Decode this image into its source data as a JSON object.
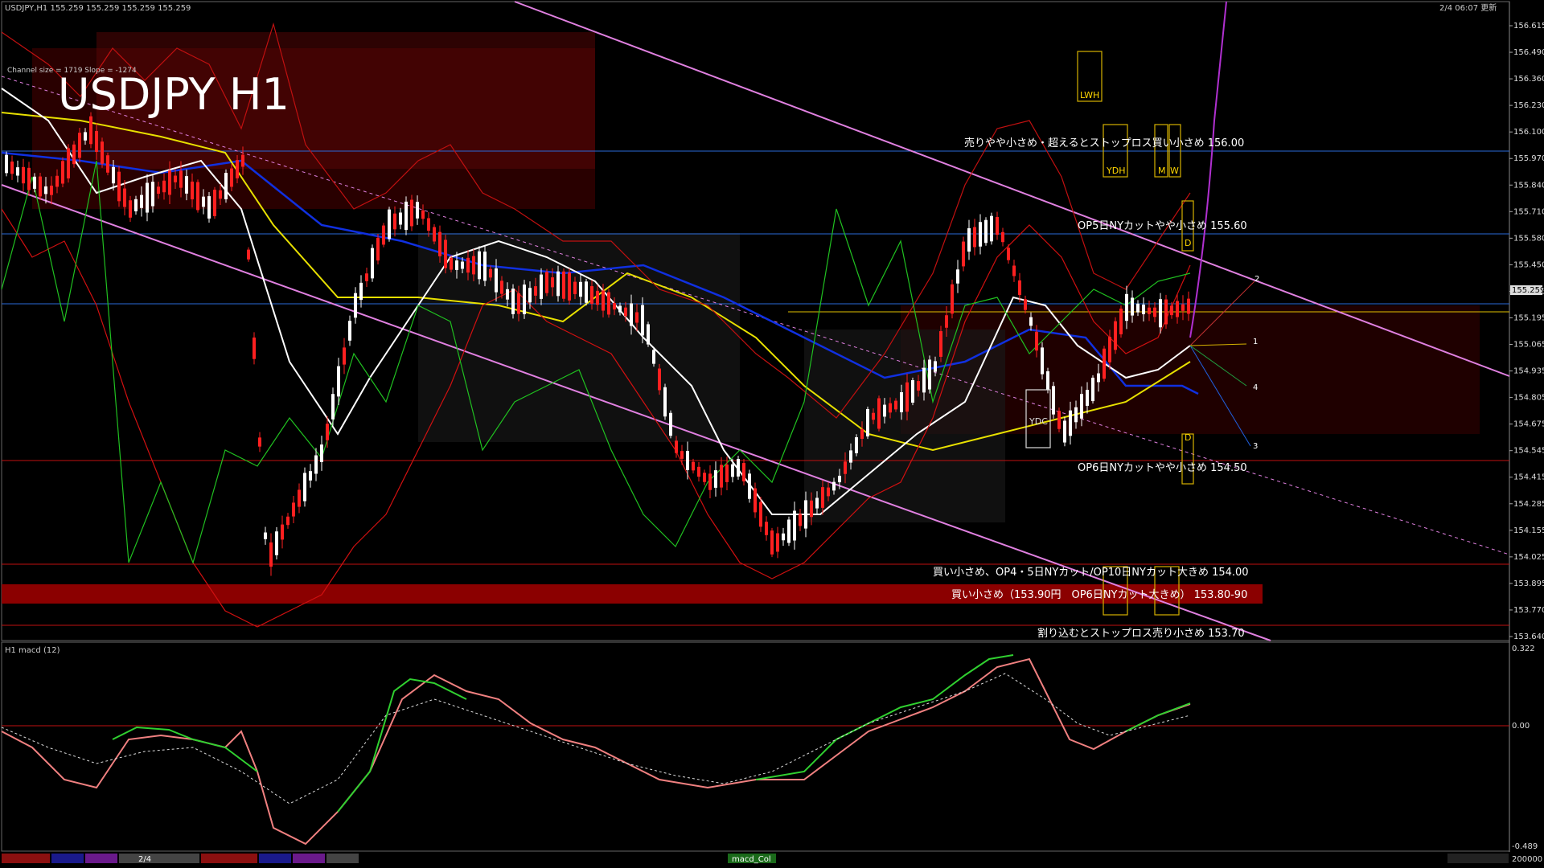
{
  "chart": {
    "header_info": "USDJPY,H1 155.259 155.259 155.259 155.259",
    "timestamp": "2/4 06:07 更新",
    "title": "USDJPY H1",
    "channel_info": "Channel size = 1719 Slope = -1274",
    "current_price": "155.259"
  },
  "chart_data": {
    "type": "line",
    "y_axis_ticks": [
      "156.615",
      "156.490",
      "156.360",
      "156.230",
      "156.100",
      "155.970",
      "155.840",
      "155.710",
      "155.580",
      "155.450",
      "155.325",
      "155.195",
      "155.065",
      "154.935",
      "154.805",
      "154.675",
      "154.545",
      "154.415",
      "154.285",
      "154.155",
      "154.025",
      "153.895",
      "153.770",
      "153.640"
    ],
    "ylim": [
      153.64,
      156.615
    ],
    "annotations": [
      {
        "text": "売りやや小さめ・超えるとストップロス買い小さめ 156.00",
        "price": 156.0
      },
      {
        "text": "OP5日NYカットやや小さめ 155.60",
        "price": 155.6
      },
      {
        "text": "OP6日NYカットやや小さめ 154.50",
        "price": 154.5
      },
      {
        "text": "買い小さめ、OP4・5日NYカット/OP10日NYカット大きめ 154.00",
        "price": 154.0
      },
      {
        "text": "買い小さめ（153.90円　OP6日NYカット大きめ） 153.80-90",
        "price": 153.85
      },
      {
        "text": "割り込むとストップロス売り小さめ 153.70",
        "price": 153.7
      }
    ],
    "zone_labels": [
      "LWH",
      "YDH",
      "M",
      "W",
      "D",
      "YDC",
      "D"
    ],
    "projection_labels": [
      "1",
      "2",
      "3",
      "4"
    ]
  },
  "macd": {
    "label": "H1  macd (12)",
    "ticks": [
      "0.322",
      "0.00",
      "-0.489"
    ],
    "ylim": [
      -0.489,
      0.322
    ]
  },
  "tabs": {
    "date_label": "2/4",
    "indicator_label": "macd_Col",
    "vol_label": "200000"
  }
}
